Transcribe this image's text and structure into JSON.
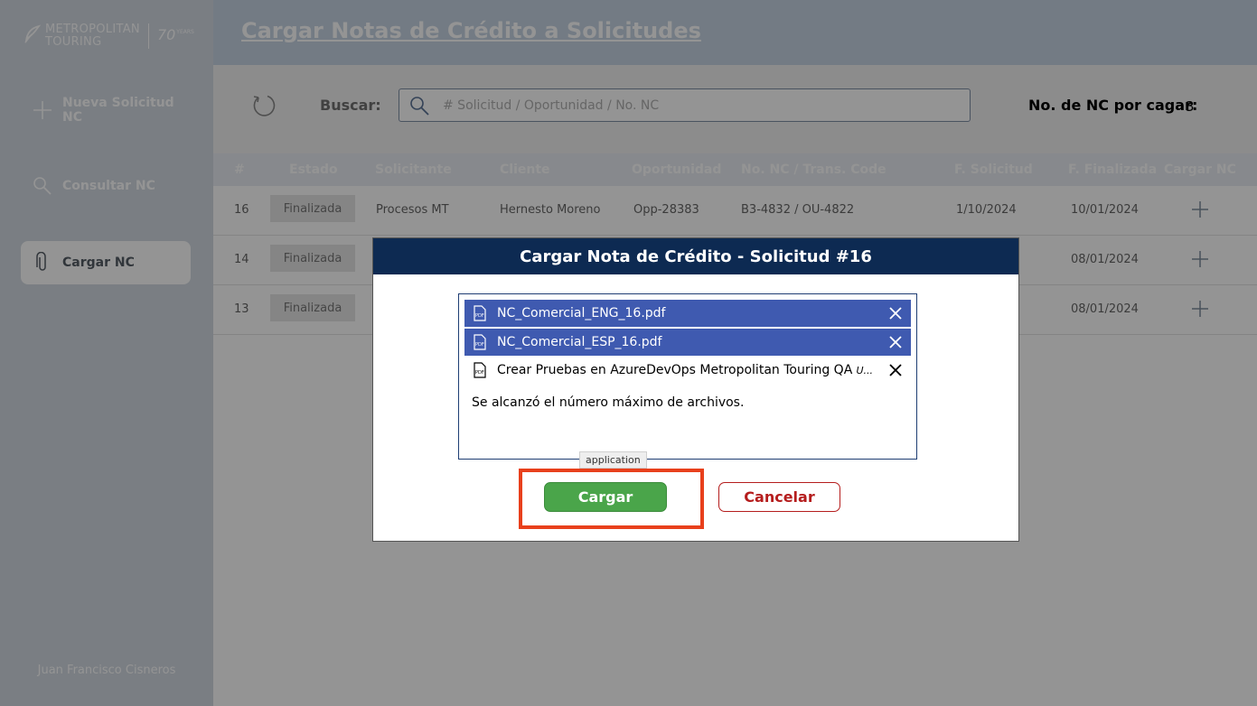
{
  "brand": {
    "name_line1": "METROPOLITAN",
    "name_line2": "TOURING",
    "anniversary": "70",
    "anniversary_suffix": "YEARS"
  },
  "sidebar": {
    "items": [
      {
        "label": "Nueva Solicitud NC",
        "icon": "plus-icon",
        "active": false
      },
      {
        "label": "Consultar NC",
        "icon": "search-icon",
        "active": false
      },
      {
        "label": "Cargar NC",
        "icon": "paperclip-icon",
        "active": true
      }
    ],
    "user_name": "Juan Francisco Cisneros"
  },
  "header": {
    "title": "Cargar Notas de Crédito a Solicitudes"
  },
  "toolbar": {
    "search_label": "Buscar:",
    "search_placeholder": "# Solicitud / Oportunidad / No. NC",
    "search_value": "",
    "nc_count_label": "No. de NC por cagar:",
    "nc_count_value": "3"
  },
  "table": {
    "columns": [
      "#",
      "Estado",
      "Solicitante",
      "Cliente",
      "Oportunidad",
      "No. NC / Trans. Code",
      "F. Solicitud",
      "F. Finalizada",
      "Cargar NC"
    ],
    "rows": [
      {
        "id": "16",
        "estado": "Finalizada",
        "solicitante": "Procesos MT",
        "cliente": "Hernesto Moreno",
        "oportunidad": "Opp-28383",
        "nc": "B3-4832 / OU-4822",
        "f_solicitud": "1/10/2024",
        "f_finalizada": "10/01/2024"
      },
      {
        "id": "14",
        "estado": "Finalizada",
        "solicitante": "",
        "cliente": "",
        "oportunidad": "",
        "nc": "",
        "f_solicitud": "",
        "f_finalizada": "08/01/2024"
      },
      {
        "id": "13",
        "estado": "Finalizada",
        "solicitante": "",
        "cliente": "",
        "oportunidad": "",
        "nc": "",
        "f_solicitud": "",
        "f_finalizada": "08/01/2024"
      }
    ]
  },
  "modal": {
    "title": "Cargar Nota de Crédito - Solicitud #16",
    "files": [
      {
        "name": "NC_Comercial_ENG_16.pdf",
        "state": "",
        "selected": true
      },
      {
        "name": "NC_Comercial_ESP_16.pdf",
        "state": "",
        "selected": true
      },
      {
        "name": "Crear Pruebas en AzureDevOps Metropolitan Touring QA | M...",
        "state": "U...",
        "selected": false
      }
    ],
    "max_message": "Se alcanzó el número máximo de archivos.",
    "tooltip": "application",
    "upload_label": "Cargar",
    "cancel_label": "Cancelar"
  },
  "colors": {
    "modal_header": "#0d2a52",
    "selected_file": "#3f5ab0",
    "upload_button": "#4aa54a",
    "cancel_button": "#b51d1d",
    "highlight": "#e8401c"
  }
}
